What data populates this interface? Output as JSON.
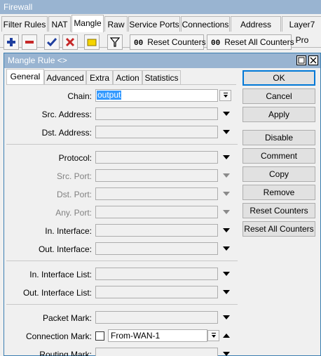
{
  "window": {
    "title": "Firewall"
  },
  "tabs": [
    "Filter Rules",
    "NAT",
    "Mangle",
    "Raw",
    "Service Ports",
    "Connections",
    "Address Lists",
    "Layer7 Pro"
  ],
  "toolbar": {
    "reset_counters": "Reset Counters",
    "reset_all_counters": "Reset All Counters",
    "counter_glyph": "00"
  },
  "dialog": {
    "title": "Mangle Rule <>",
    "tabs": [
      "General",
      "Advanced",
      "Extra",
      "Action",
      "Statistics"
    ],
    "fields": {
      "chain": {
        "label": "Chain:",
        "value": "output"
      },
      "src_address": {
        "label": "Src. Address:"
      },
      "dst_address": {
        "label": "Dst. Address:"
      },
      "protocol": {
        "label": "Protocol:"
      },
      "src_port": {
        "label": "Src. Port:"
      },
      "dst_port": {
        "label": "Dst. Port:"
      },
      "any_port": {
        "label": "Any. Port:"
      },
      "in_interface": {
        "label": "In. Interface:"
      },
      "out_interface": {
        "label": "Out. Interface:"
      },
      "in_interface_list": {
        "label": "In. Interface List:"
      },
      "out_interface_list": {
        "label": "Out. Interface List:"
      },
      "packet_mark": {
        "label": "Packet Mark:"
      },
      "connection_mark": {
        "label": "Connection Mark:",
        "value": "From-WAN-1"
      },
      "routing_mark": {
        "label": "Routing Mark:"
      }
    },
    "buttons": [
      "OK",
      "Cancel",
      "Apply",
      "Disable",
      "Comment",
      "Copy",
      "Remove",
      "Reset Counters",
      "Reset All Counters"
    ]
  },
  "colors": {
    "title_bar": "#99b4d1",
    "selection": "#3399ff",
    "add_icon": "#1f3f9f",
    "remove_icon": "#c62828",
    "check_icon": "#1f3f9f",
    "cross_icon": "#c62828",
    "note_icon": "#f5d400"
  }
}
